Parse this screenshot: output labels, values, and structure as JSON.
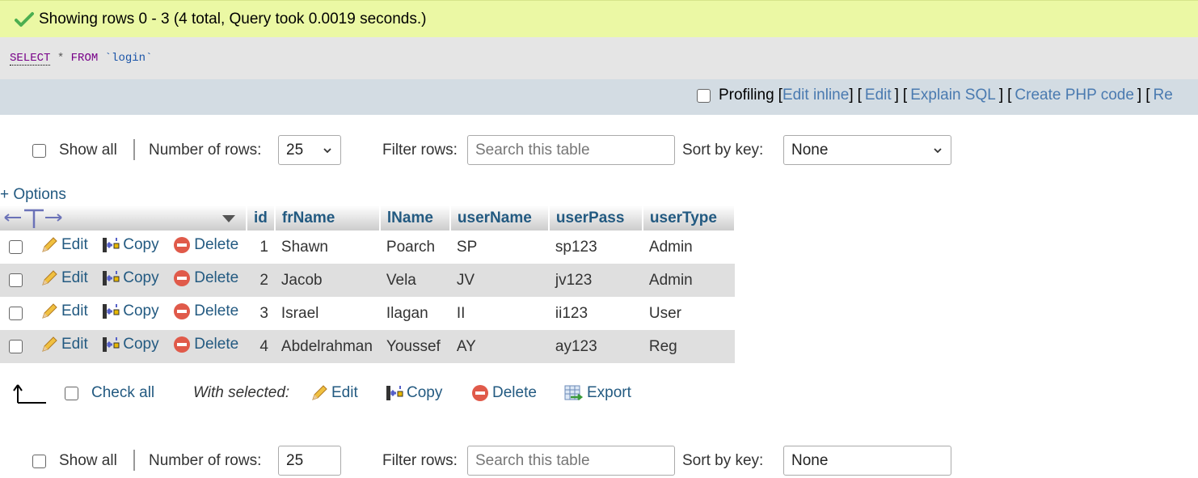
{
  "status": {
    "message": "Showing rows 0 - 3 (4 total, Query took 0.0019 seconds.)",
    "icon": "check-icon"
  },
  "query": {
    "select": "SELECT",
    "star": "*",
    "from": "FROM",
    "table": "`login`"
  },
  "toolbar": {
    "profiling_label": "Profiling",
    "links": [
      "Edit inline",
      "Edit",
      "Explain SQL",
      "Create PHP code",
      "Re"
    ]
  },
  "navigation": {
    "show_all_label": "Show all",
    "num_rows_label": "Number of rows:",
    "num_rows_value": "25",
    "filter_label": "Filter rows:",
    "filter_placeholder": "Search this table",
    "sort_label": "Sort by key:",
    "sort_value": "None"
  },
  "options_label": "+ Options",
  "table": {
    "columns": [
      "id",
      "frName",
      "lName",
      "userName",
      "userPass",
      "userType"
    ],
    "actions": {
      "edit": "Edit",
      "copy": "Copy",
      "delete": "Delete"
    },
    "rows": [
      {
        "id": "1",
        "frName": "Shawn",
        "lName": "Poarch",
        "userName": "SP",
        "userPass": "sp123",
        "userType": "Admin"
      },
      {
        "id": "2",
        "frName": "Jacob",
        "lName": "Vela",
        "userName": "JV",
        "userPass": "jv123",
        "userType": "Admin"
      },
      {
        "id": "3",
        "frName": "Israel",
        "lName": "Ilagan",
        "userName": "II",
        "userPass": "ii123",
        "userType": "User"
      },
      {
        "id": "4",
        "frName": "Abdelrahman",
        "lName": "Youssef",
        "userName": "AY",
        "userPass": "ay123",
        "userType": "Reg"
      }
    ]
  },
  "bulk": {
    "check_all": "Check all",
    "with_selected": "With selected:",
    "edit": "Edit",
    "copy": "Copy",
    "delete": "Delete",
    "export": "Export"
  },
  "colors": {
    "link": "#235a81",
    "success_bg": "#ebf8a4",
    "toolbar_bg": "#d3dce3",
    "sql_bg": "#e5e5e5",
    "row_alt": "#dfdfdf"
  }
}
